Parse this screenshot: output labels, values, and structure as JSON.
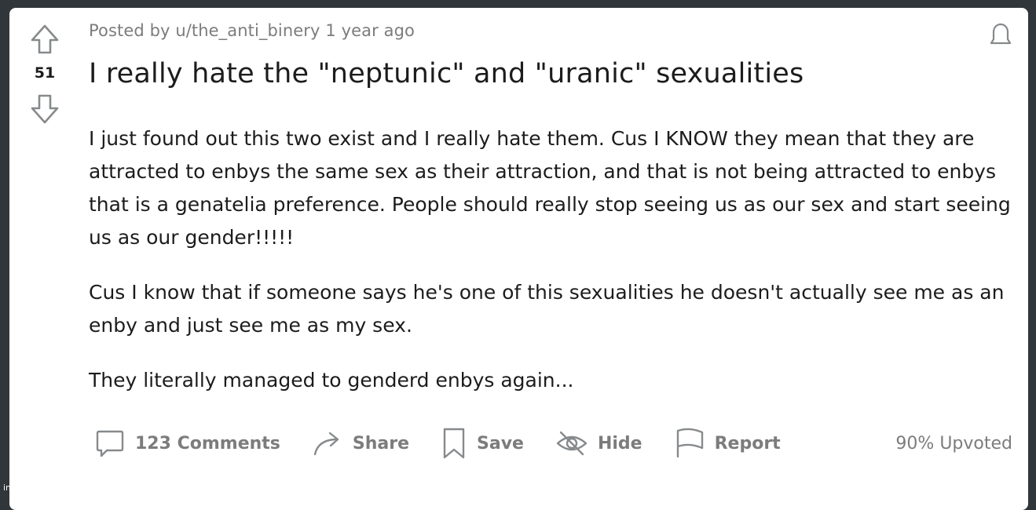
{
  "post": {
    "score": "51",
    "meta_prefix": "Posted by",
    "author": "u/the_anti_binery",
    "age": "1 year ago",
    "title": "I really hate the \"neptunic\" and \"uranic\" sexualities",
    "paragraphs": [
      "I just found out this two exist and I really hate them. Cus I KNOW they mean that they are attracted to enbys the same sex as their attraction, and that is not being attracted to enbys that is a genatelia preference. People should really stop seeing us as our sex and start seeing us as our gender!!!!!",
      "Cus I know that if someone says he's one of this sexualities he doesn't actually see me as an enby and just see me as my sex.",
      "They literally managed to genderd enbys again..."
    ]
  },
  "actions": {
    "comments_label": "123 Comments",
    "share_label": "Share",
    "save_label": "Save",
    "hide_label": "Hide",
    "report_label": "Report",
    "upvoted_label": "90% Upvoted"
  },
  "icons": {
    "upvote": "arrow-up-outline-icon",
    "downvote": "arrow-down-outline-icon",
    "bell": "bell-icon",
    "comments": "speech-bubble-icon",
    "share": "share-arrow-icon",
    "save": "bookmark-icon",
    "hide": "eye-slash-icon",
    "report": "flag-icon"
  },
  "watermark": "imgflip.com",
  "colors": {
    "background": "#30363a",
    "card": "#ffffff",
    "text": "#1c1c1c",
    "muted": "#7c7c7c"
  }
}
